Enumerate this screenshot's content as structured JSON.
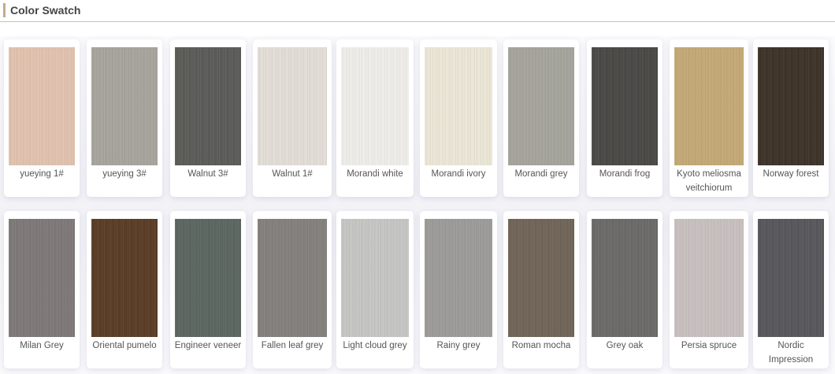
{
  "header": {
    "title": "Color Swatch"
  },
  "rows": [
    [
      {
        "name": "yueying 1#",
        "color": "#e0c2ae"
      },
      {
        "name": "yueying 3#",
        "color": "#a7a49d"
      },
      {
        "name": "Walnut 3#",
        "color": "#5b5b58"
      },
      {
        "name": "Walnut 1#",
        "color": "#e2ddd6"
      },
      {
        "name": "Morandi white",
        "color": "#eeede9"
      },
      {
        "name": "Morandi ivory",
        "color": "#ebe6d6"
      },
      {
        "name": "Morandi grey",
        "color": "#a5a49c"
      },
      {
        "name": "Morandi frog",
        "color": "#4b4946"
      },
      {
        "name": "Kyoto meliosma veitchiorum",
        "color": "#c4a876"
      },
      {
        "name": "Norway forest",
        "color": "#3e3329"
      }
    ],
    [
      {
        "name": "Milan Grey",
        "color": "#7e7878"
      },
      {
        "name": "Oriental pumelo",
        "color": "#5a3d26"
      },
      {
        "name": "Engineer veneer",
        "color": "#5c6660"
      },
      {
        "name": "Fallen leaf grey",
        "color": "#84807c"
      },
      {
        "name": "Light cloud grey",
        "color": "#c5c6c3"
      },
      {
        "name": "Rainy grey",
        "color": "#9d9b99"
      },
      {
        "name": "Roman mocha",
        "color": "#716458"
      },
      {
        "name": "Grey oak",
        "color": "#6b6a68"
      },
      {
        "name": "Persia spruce",
        "color": "#c8bfbf"
      },
      {
        "name": "Nordic Impression",
        "color": "#58575b"
      }
    ]
  ]
}
